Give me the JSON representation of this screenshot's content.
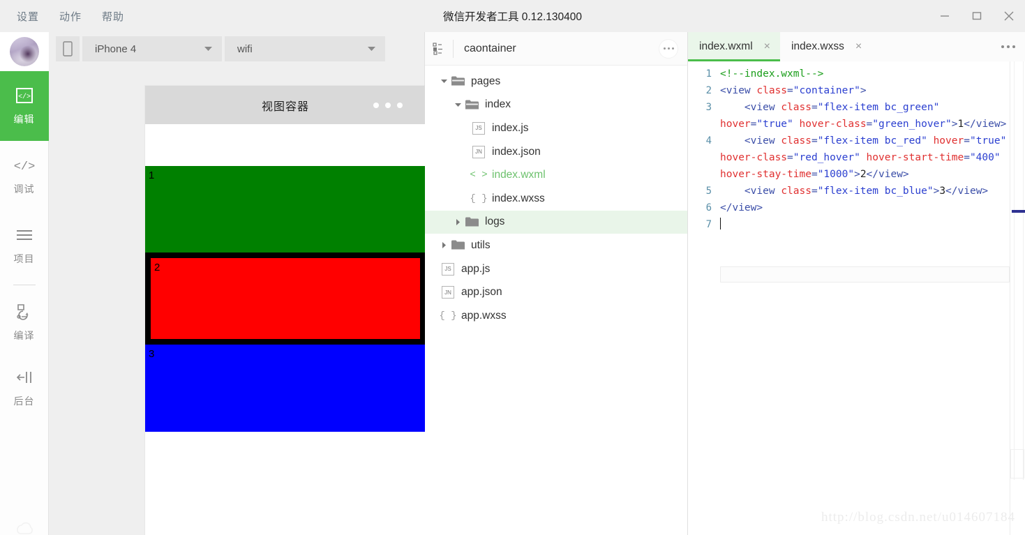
{
  "window": {
    "title": "微信开发者工具 0.12.130400",
    "menu": [
      {
        "label": "设置",
        "name": "menu-settings"
      },
      {
        "label": "动作",
        "name": "menu-actions"
      },
      {
        "label": "帮助",
        "name": "menu-help"
      }
    ],
    "controls": {
      "minimize": "minimize-icon",
      "maximize": "maximize-icon",
      "close": "close-icon"
    }
  },
  "sidebar": {
    "avatar": "user-avatar",
    "items": [
      {
        "label": "编辑",
        "icon": "code-box-icon",
        "active": true
      },
      {
        "label": "调试",
        "icon": "angle-brackets-icon",
        "active": false
      },
      {
        "label": "项目",
        "icon": "hamburger-icon",
        "active": false
      },
      {
        "label": "编译",
        "icon": "compile-refresh-icon",
        "active": false
      },
      {
        "label": "后台",
        "icon": "background-toggle-icon",
        "active": false
      }
    ]
  },
  "simulator": {
    "device_icon": "device-phone-icon",
    "device": "iPhone 4",
    "network": "wifi",
    "phone": {
      "title": "视图容器",
      "dots": "three-dots-indicator",
      "items": [
        {
          "label": "1",
          "class": "flex-item bc_green",
          "color": "#008000"
        },
        {
          "label": "2",
          "class": "flex-item bc_red",
          "color": "#ff0000"
        },
        {
          "label": "3",
          "class": "flex-item bc_blue",
          "color": "#0000ff"
        }
      ]
    }
  },
  "filetree": {
    "header": {
      "icon": "project-tree-icon",
      "name": "caontainer",
      "more": "more-options-button"
    },
    "rows": [
      {
        "label": "pages",
        "type": "folder",
        "indent": 0,
        "expanded": true,
        "selected": false
      },
      {
        "label": "index",
        "type": "folder",
        "indent": 1,
        "expanded": true,
        "selected": false
      },
      {
        "label": "index.js",
        "type": "js",
        "indent": 2,
        "selected": false
      },
      {
        "label": "index.json",
        "type": "json",
        "indent": 2,
        "selected": false
      },
      {
        "label": "index.wxml",
        "type": "wxml",
        "indent": 2,
        "selected": false
      },
      {
        "label": "index.wxss",
        "type": "wxss",
        "indent": 2,
        "selected": false
      },
      {
        "label": "logs",
        "type": "folder",
        "indent": 1,
        "expanded": false,
        "selected": true
      },
      {
        "label": "utils",
        "type": "folder",
        "indent": 0,
        "expanded": false,
        "selected": false
      },
      {
        "label": "app.js",
        "type": "js",
        "indent": 0,
        "selected": false
      },
      {
        "label": "app.json",
        "type": "json",
        "indent": 0,
        "selected": false
      },
      {
        "label": "app.wxss",
        "type": "wxss",
        "indent": 0,
        "selected": false
      }
    ]
  },
  "editor": {
    "tabs": [
      {
        "label": "index.wxml",
        "active": true,
        "close": "×"
      },
      {
        "label": "index.wxss",
        "active": false,
        "close": "×"
      }
    ],
    "more": "editor-more-button",
    "code": [
      {
        "num": "1",
        "html": "<span class=\"tk-com\">&lt;!--index.wxml--&gt;</span>"
      },
      {
        "num": "2",
        "html": "<span class=\"tk-tag\">&lt;view </span><span class=\"tk-attr\">class</span><span class=\"tk-tag\">=</span><span class=\"tk-val\">\"container\"</span><span class=\"tk-tag\">&gt;</span>"
      },
      {
        "num": "3",
        "html": "    <span class=\"tk-tag\">&lt;view </span><span class=\"tk-attr\">class</span><span class=\"tk-tag\">=</span><span class=\"tk-val\">\"flex-item bc_green\"</span> <span class=\"tk-attr\">hover</span><span class=\"tk-tag\">=</span><span class=\"tk-val\">\"true\"</span> <span class=\"tk-attr\">hover-class</span><span class=\"tk-tag\">=</span><span class=\"tk-val\">\"green_hover\"</span><span class=\"tk-tag\">&gt;</span><span class=\"tk-txt\">1</span><span class=\"tk-tag\">&lt;/view&gt;</span>"
      },
      {
        "num": "4",
        "html": "    <span class=\"tk-tag\">&lt;view </span><span class=\"tk-attr\">class</span><span class=\"tk-tag\">=</span><span class=\"tk-val\">\"flex-item bc_red\"</span> <span class=\"tk-attr\">hover</span><span class=\"tk-tag\">=</span><span class=\"tk-val\">\"true\"</span> <span class=\"tk-attr\">hover-class</span><span class=\"tk-tag\">=</span><span class=\"tk-val\">\"red_hover\"</span> <span class=\"tk-attr\">hover-start-time</span><span class=\"tk-tag\">=</span><span class=\"tk-val\">\"400\"</span> <span class=\"tk-attr\">hover-stay-time</span><span class=\"tk-tag\">=</span><span class=\"tk-val\">\"1000\"</span><span class=\"tk-tag\">&gt;</span><span class=\"tk-txt\">2</span><span class=\"tk-tag\">&lt;/view&gt;</span>"
      },
      {
        "num": "5",
        "html": "    <span class=\"tk-tag\">&lt;view </span><span class=\"tk-attr\">class</span><span class=\"tk-tag\">=</span><span class=\"tk-val\">\"flex-item bc_blue\"</span><span class=\"tk-tag\">&gt;</span><span class=\"tk-txt\">3</span><span class=\"tk-tag\">&lt;/view&gt;</span>"
      },
      {
        "num": "6",
        "html": "<span class=\"tk-tag\">&lt;/view&gt;</span>"
      },
      {
        "num": "7",
        "html": "<span class=\"caret-line\"></span>"
      }
    ],
    "watermark": "http://blog.csdn.net/u014607184"
  },
  "colors": {
    "accent_green": "#4bbd4b",
    "tab_active_bg": "#eaf6ea",
    "tree_selected_bg": "#e9f5e9",
    "green_box": "#008000",
    "red_box": "#ff0000",
    "blue_box": "#0000ff"
  }
}
